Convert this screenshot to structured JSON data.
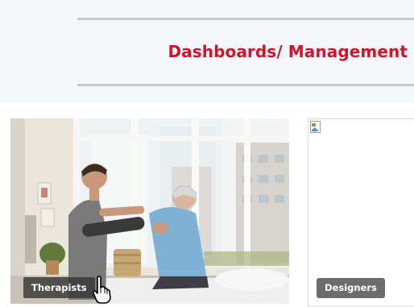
{
  "header": {
    "title": "Dashboards/ Management"
  },
  "cards": [
    {
      "label": "Therapists",
      "image": "therapy-session-photo"
    },
    {
      "label": "Designers",
      "image": "broken-image-icon"
    }
  ],
  "colors": {
    "title": "#d0152a",
    "header_background": "#f4f6f9",
    "rule": "#c8c8c8",
    "badge_dark": "#373737",
    "badge_grey": "#6c6c6c"
  }
}
